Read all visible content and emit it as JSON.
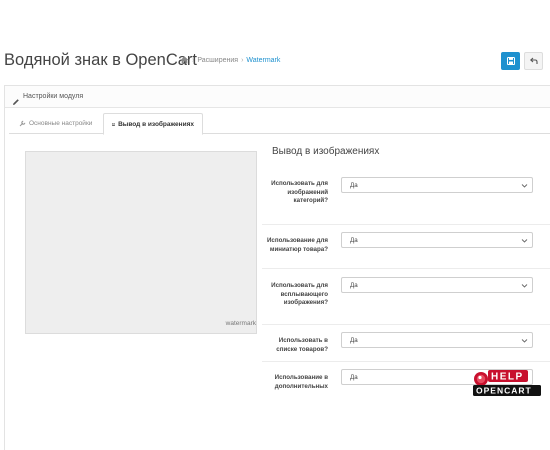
{
  "header": {
    "title": "Водяной знак в OpenCart",
    "breadcrumb": [
      "Расширения",
      "Watermark"
    ],
    "icons": {
      "home": "home-icon",
      "save": "save-icon",
      "back": "back-arrow-icon"
    },
    "colors": {
      "primary": "#1e91cf"
    }
  },
  "panel": {
    "title": "Настройки модуля",
    "icon": "pencil-icon"
  },
  "tabs": [
    {
      "label": "Основные настройки",
      "icon": "wrench-icon",
      "active": false
    },
    {
      "label": "Вывод в изображениях",
      "icon": "image-icon",
      "active": true
    }
  ],
  "preview": {
    "label": "watermark"
  },
  "section": {
    "title": "Вывод в изображениях",
    "rows": [
      {
        "label": "Использовать для изображений категорий?",
        "value": "Да"
      },
      {
        "label": "Использование для миниатюр товара?",
        "value": "Да"
      },
      {
        "label": "Использовать для всплывающего изображения?",
        "value": "Да"
      },
      {
        "label": "Использовать в списке товаров?",
        "value": "Да"
      },
      {
        "label": "Использование в дополнительных",
        "value": "Да"
      }
    ]
  },
  "logo": {
    "line1": "HELP",
    "line2": "OPENCART"
  }
}
